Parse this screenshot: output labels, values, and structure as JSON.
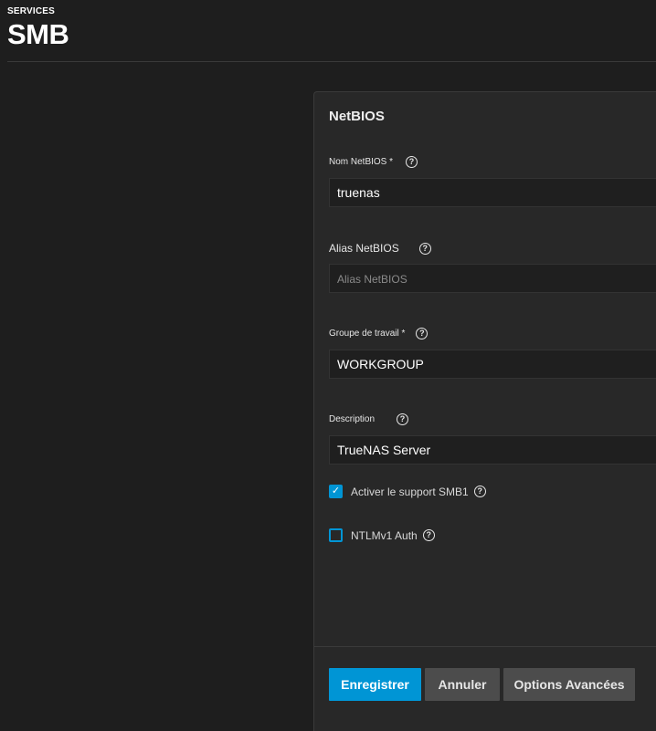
{
  "header": {
    "breadcrumb": "SERVICES",
    "title": "SMB"
  },
  "form": {
    "section_title": "NetBIOS",
    "netbios_name": {
      "label": "Nom NetBIOS *",
      "value": "truenas"
    },
    "netbios_alias": {
      "label": "Alias NetBIOS",
      "value": "",
      "placeholder": "Alias NetBIOS"
    },
    "workgroup": {
      "label": "Groupe de travail *",
      "value": "WORKGROUP"
    },
    "description": {
      "label": "Description",
      "value": "TrueNAS Server"
    },
    "smb1": {
      "label": "Activer le support SMB1",
      "checked": true
    },
    "ntlmv1": {
      "label": "NTLMv1 Auth",
      "checked": false
    }
  },
  "actions": {
    "save_label": "Enregistrer",
    "cancel_label": "Annuler",
    "advanced_label": "Options Avancées"
  },
  "icons": {
    "help": "help-circle-icon",
    "check": "checkmark-icon"
  },
  "colors": {
    "accent": "#0095d5",
    "background": "#1e1e1e",
    "card": "#282828"
  }
}
